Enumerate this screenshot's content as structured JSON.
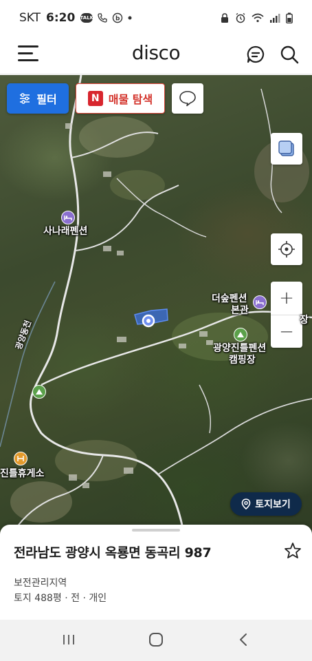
{
  "status_bar": {
    "carrier": "SKT",
    "time": "6:20",
    "icons": [
      "talk-icon",
      "call-icon",
      "b-app-icon",
      "dot-icon",
      "lock-icon",
      "alarm-icon",
      "wifi-icon",
      "signal-icon",
      "battery-icon"
    ],
    "talk_badge": "TALK"
  },
  "header": {
    "logo": "disco",
    "icons": [
      "menu-icon",
      "chat-search-icon",
      "search-icon"
    ]
  },
  "map": {
    "filter_label": "필터",
    "explore_badge": "N",
    "explore_label": "매물 탐색",
    "zoom_in": "+",
    "zoom_out": "−",
    "land_view_label": "토지보기",
    "labels": {
      "sanarae": "사나래펜션",
      "deosup_1": "더숲펜션",
      "deosup_2": "본관",
      "gwangyang_1": "광양진틀펜션",
      "gwangyang_2": "캠핑장",
      "rest_area": "진틀휴게소",
      "stream": "광양동천",
      "edge": "장"
    },
    "accent_color": "#1f6fe0",
    "explore_color": "#d8262e",
    "parcel_color": "#3b6fe0"
  },
  "sheet": {
    "address": "전라남도 광양시 옥룡면 동곡리 987",
    "zone": "보전관리지역",
    "info": "토지 488평 · 전 · 개인"
  },
  "nav_bar": {
    "buttons": [
      "recent-apps-icon",
      "home-icon",
      "back-icon"
    ]
  }
}
